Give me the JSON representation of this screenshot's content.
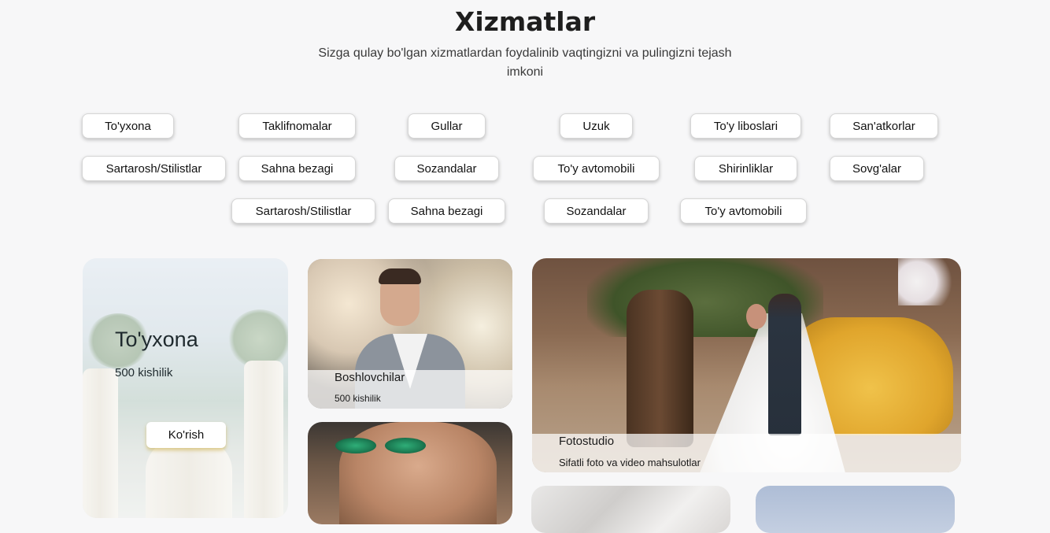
{
  "header": {
    "title": "Xizmatlar",
    "subtitle": "Sizga qulay bo'lgan xizmatlardan foydalinib vaqtingizni va pulingizni tejash imkoni"
  },
  "categories": [
    "To'yxona",
    "Taklifnomalar",
    "Gullar",
    "Uzuk",
    "To'y liboslari",
    "San'atkorlar",
    "Sartarosh/Stilistlar",
    "Sahna bezagi",
    "Sozandalar",
    "To'y avtomobili",
    "Shirinliklar",
    "Sovg'alar",
    "Sartarosh/Stilistlar",
    "Sahna bezagi",
    "Sozandalar",
    "To'y avtomobili"
  ],
  "cards": {
    "venue": {
      "title": "To'yxona",
      "subtitle": "500 kishilik",
      "button": "Ko'rish"
    },
    "host": {
      "title": "Boshlovchilar",
      "subtitle": "500 kishilik"
    },
    "studio": {
      "title": "Fotostudio",
      "subtitle": "Sifatli foto va video mahsulotlar"
    }
  }
}
